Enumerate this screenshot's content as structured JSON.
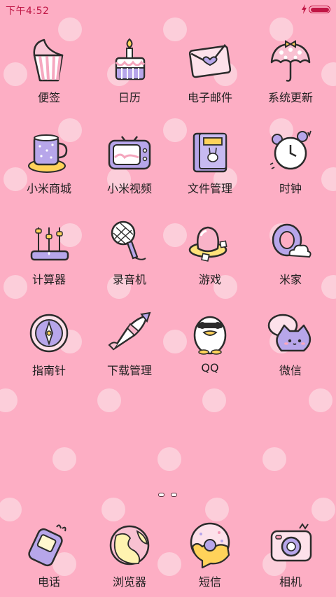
{
  "status_bar": {
    "time": "下午4:52",
    "charging_icon": "lightning-bolt-icon",
    "battery_level": 1.0
  },
  "apps": [
    {
      "label": "便签",
      "icon": "notes-icon"
    },
    {
      "label": "日历",
      "icon": "calendar-cake-icon"
    },
    {
      "label": "电子邮件",
      "icon": "email-envelope-icon"
    },
    {
      "label": "系统更新",
      "icon": "umbrella-icon"
    },
    {
      "label": "小米商城",
      "icon": "mug-icon"
    },
    {
      "label": "小米视频",
      "icon": "tv-icon"
    },
    {
      "label": "文件管理",
      "icon": "notebook-icon"
    },
    {
      "label": "时钟",
      "icon": "alarm-clock-icon"
    },
    {
      "label": "计算器",
      "icon": "abacus-icon"
    },
    {
      "label": "录音机",
      "icon": "microphone-icon"
    },
    {
      "label": "游戏",
      "icon": "game-jelly-icon"
    },
    {
      "label": "米家",
      "icon": "cloud-ring-icon"
    },
    {
      "label": "指南针",
      "icon": "compass-icon"
    },
    {
      "label": "下载管理",
      "icon": "rocket-icon"
    },
    {
      "label": "QQ",
      "icon": "penguin-icon"
    },
    {
      "label": "微信",
      "icon": "cat-chat-icon"
    }
  ],
  "page_indicator": {
    "pages": 2,
    "current": 1
  },
  "dock": [
    {
      "label": "电话",
      "icon": "phone-icon"
    },
    {
      "label": "浏览器",
      "icon": "globe-icon"
    },
    {
      "label": "短信",
      "icon": "donut-message-icon"
    },
    {
      "label": "相机",
      "icon": "camera-icon"
    }
  ],
  "colors": {
    "background": "#fdaec4",
    "dots": "#fcd2dd",
    "status_text": "#c01645",
    "label": "#1f1f1f"
  }
}
